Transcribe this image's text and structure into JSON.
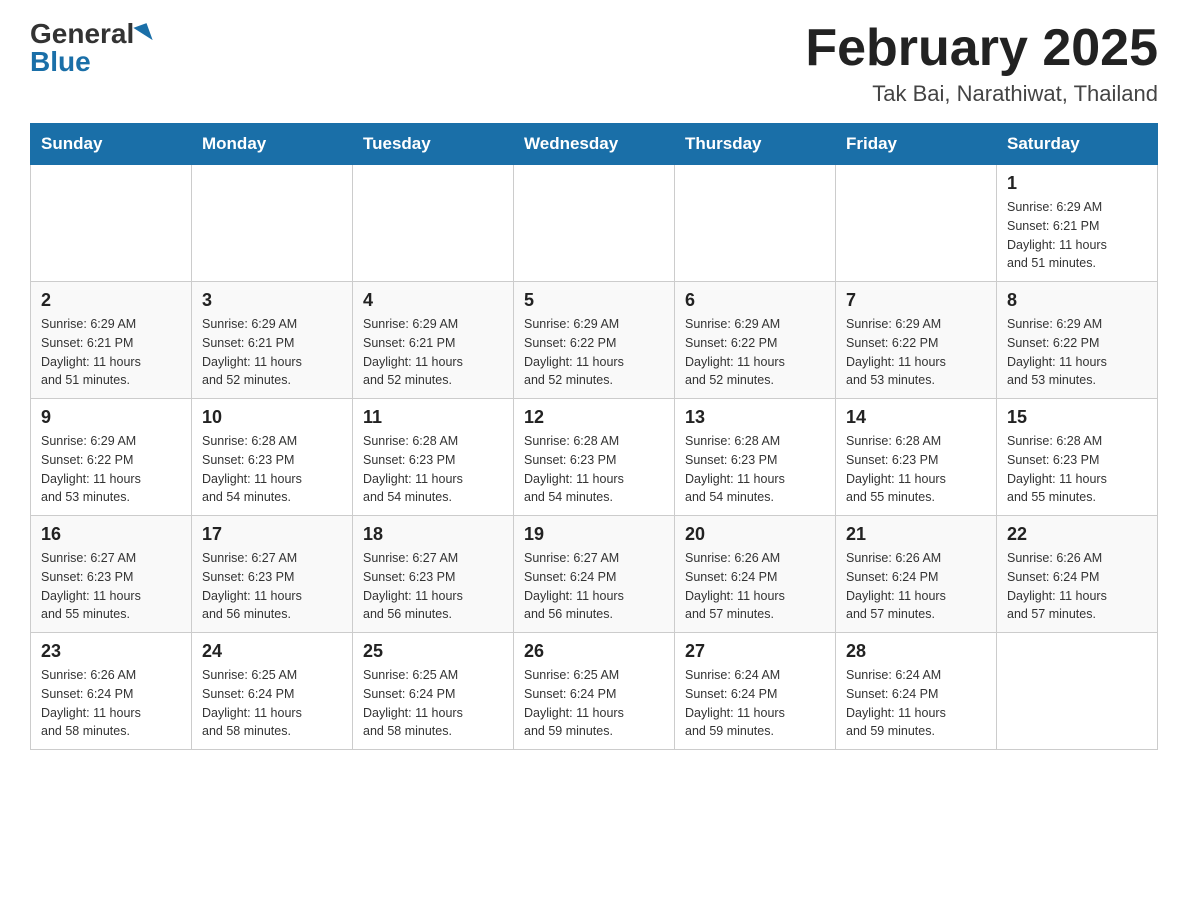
{
  "logo": {
    "general": "General",
    "blue": "Blue"
  },
  "title": "February 2025",
  "subtitle": "Tak Bai, Narathiwat, Thailand",
  "days_of_week": [
    "Sunday",
    "Monday",
    "Tuesday",
    "Wednesday",
    "Thursday",
    "Friday",
    "Saturday"
  ],
  "weeks": [
    {
      "days": [
        {
          "number": "",
          "info": ""
        },
        {
          "number": "",
          "info": ""
        },
        {
          "number": "",
          "info": ""
        },
        {
          "number": "",
          "info": ""
        },
        {
          "number": "",
          "info": ""
        },
        {
          "number": "",
          "info": ""
        },
        {
          "number": "1",
          "info": "Sunrise: 6:29 AM\nSunset: 6:21 PM\nDaylight: 11 hours\nand 51 minutes."
        }
      ]
    },
    {
      "days": [
        {
          "number": "2",
          "info": "Sunrise: 6:29 AM\nSunset: 6:21 PM\nDaylight: 11 hours\nand 51 minutes."
        },
        {
          "number": "3",
          "info": "Sunrise: 6:29 AM\nSunset: 6:21 PM\nDaylight: 11 hours\nand 52 minutes."
        },
        {
          "number": "4",
          "info": "Sunrise: 6:29 AM\nSunset: 6:21 PM\nDaylight: 11 hours\nand 52 minutes."
        },
        {
          "number": "5",
          "info": "Sunrise: 6:29 AM\nSunset: 6:22 PM\nDaylight: 11 hours\nand 52 minutes."
        },
        {
          "number": "6",
          "info": "Sunrise: 6:29 AM\nSunset: 6:22 PM\nDaylight: 11 hours\nand 52 minutes."
        },
        {
          "number": "7",
          "info": "Sunrise: 6:29 AM\nSunset: 6:22 PM\nDaylight: 11 hours\nand 53 minutes."
        },
        {
          "number": "8",
          "info": "Sunrise: 6:29 AM\nSunset: 6:22 PM\nDaylight: 11 hours\nand 53 minutes."
        }
      ]
    },
    {
      "days": [
        {
          "number": "9",
          "info": "Sunrise: 6:29 AM\nSunset: 6:22 PM\nDaylight: 11 hours\nand 53 minutes."
        },
        {
          "number": "10",
          "info": "Sunrise: 6:28 AM\nSunset: 6:23 PM\nDaylight: 11 hours\nand 54 minutes."
        },
        {
          "number": "11",
          "info": "Sunrise: 6:28 AM\nSunset: 6:23 PM\nDaylight: 11 hours\nand 54 minutes."
        },
        {
          "number": "12",
          "info": "Sunrise: 6:28 AM\nSunset: 6:23 PM\nDaylight: 11 hours\nand 54 minutes."
        },
        {
          "number": "13",
          "info": "Sunrise: 6:28 AM\nSunset: 6:23 PM\nDaylight: 11 hours\nand 54 minutes."
        },
        {
          "number": "14",
          "info": "Sunrise: 6:28 AM\nSunset: 6:23 PM\nDaylight: 11 hours\nand 55 minutes."
        },
        {
          "number": "15",
          "info": "Sunrise: 6:28 AM\nSunset: 6:23 PM\nDaylight: 11 hours\nand 55 minutes."
        }
      ]
    },
    {
      "days": [
        {
          "number": "16",
          "info": "Sunrise: 6:27 AM\nSunset: 6:23 PM\nDaylight: 11 hours\nand 55 minutes."
        },
        {
          "number": "17",
          "info": "Sunrise: 6:27 AM\nSunset: 6:23 PM\nDaylight: 11 hours\nand 56 minutes."
        },
        {
          "number": "18",
          "info": "Sunrise: 6:27 AM\nSunset: 6:23 PM\nDaylight: 11 hours\nand 56 minutes."
        },
        {
          "number": "19",
          "info": "Sunrise: 6:27 AM\nSunset: 6:24 PM\nDaylight: 11 hours\nand 56 minutes."
        },
        {
          "number": "20",
          "info": "Sunrise: 6:26 AM\nSunset: 6:24 PM\nDaylight: 11 hours\nand 57 minutes."
        },
        {
          "number": "21",
          "info": "Sunrise: 6:26 AM\nSunset: 6:24 PM\nDaylight: 11 hours\nand 57 minutes."
        },
        {
          "number": "22",
          "info": "Sunrise: 6:26 AM\nSunset: 6:24 PM\nDaylight: 11 hours\nand 57 minutes."
        }
      ]
    },
    {
      "days": [
        {
          "number": "23",
          "info": "Sunrise: 6:26 AM\nSunset: 6:24 PM\nDaylight: 11 hours\nand 58 minutes."
        },
        {
          "number": "24",
          "info": "Sunrise: 6:25 AM\nSunset: 6:24 PM\nDaylight: 11 hours\nand 58 minutes."
        },
        {
          "number": "25",
          "info": "Sunrise: 6:25 AM\nSunset: 6:24 PM\nDaylight: 11 hours\nand 58 minutes."
        },
        {
          "number": "26",
          "info": "Sunrise: 6:25 AM\nSunset: 6:24 PM\nDaylight: 11 hours\nand 59 minutes."
        },
        {
          "number": "27",
          "info": "Sunrise: 6:24 AM\nSunset: 6:24 PM\nDaylight: 11 hours\nand 59 minutes."
        },
        {
          "number": "28",
          "info": "Sunrise: 6:24 AM\nSunset: 6:24 PM\nDaylight: 11 hours\nand 59 minutes."
        },
        {
          "number": "",
          "info": ""
        }
      ]
    }
  ]
}
